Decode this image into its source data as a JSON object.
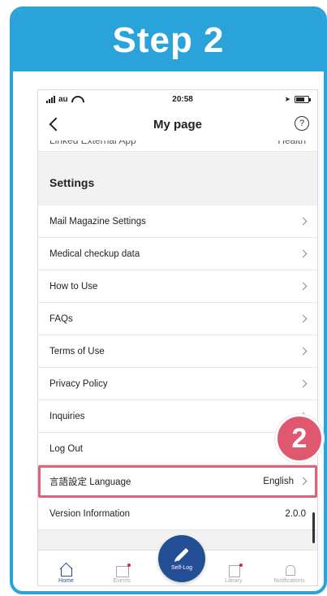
{
  "header": {
    "title": "Step 2"
  },
  "status_bar": {
    "carrier": "au",
    "time": "20:58"
  },
  "nav": {
    "title": "My page",
    "help": "?"
  },
  "cut_row": {
    "label": "Linked External App",
    "value": "Health"
  },
  "settings": {
    "title": "Settings",
    "items": [
      {
        "label": "Mail Magazine Settings",
        "value": ""
      },
      {
        "label": "Medical checkup data",
        "value": ""
      },
      {
        "label": "How to Use",
        "value": ""
      },
      {
        "label": "FAQs",
        "value": ""
      },
      {
        "label": "Terms of Use",
        "value": ""
      },
      {
        "label": "Privacy Policy",
        "value": ""
      },
      {
        "label": "Inquiries",
        "value": ""
      },
      {
        "label": "Log Out",
        "value": ""
      },
      {
        "label": "言語設定 Language",
        "value": "English"
      },
      {
        "label": "Version Information",
        "value": "2.0.0"
      }
    ]
  },
  "tabs": {
    "home": "Home",
    "events": "Events",
    "self_log": "Self-Log",
    "library": "Library",
    "notifications": "Notifications"
  },
  "badge": {
    "number": "2"
  },
  "colors": {
    "brand_blue": "#2aa3da",
    "nav_blue": "#244f97",
    "highlight_red": "#e26177",
    "badge_pink": "#e05870"
  }
}
